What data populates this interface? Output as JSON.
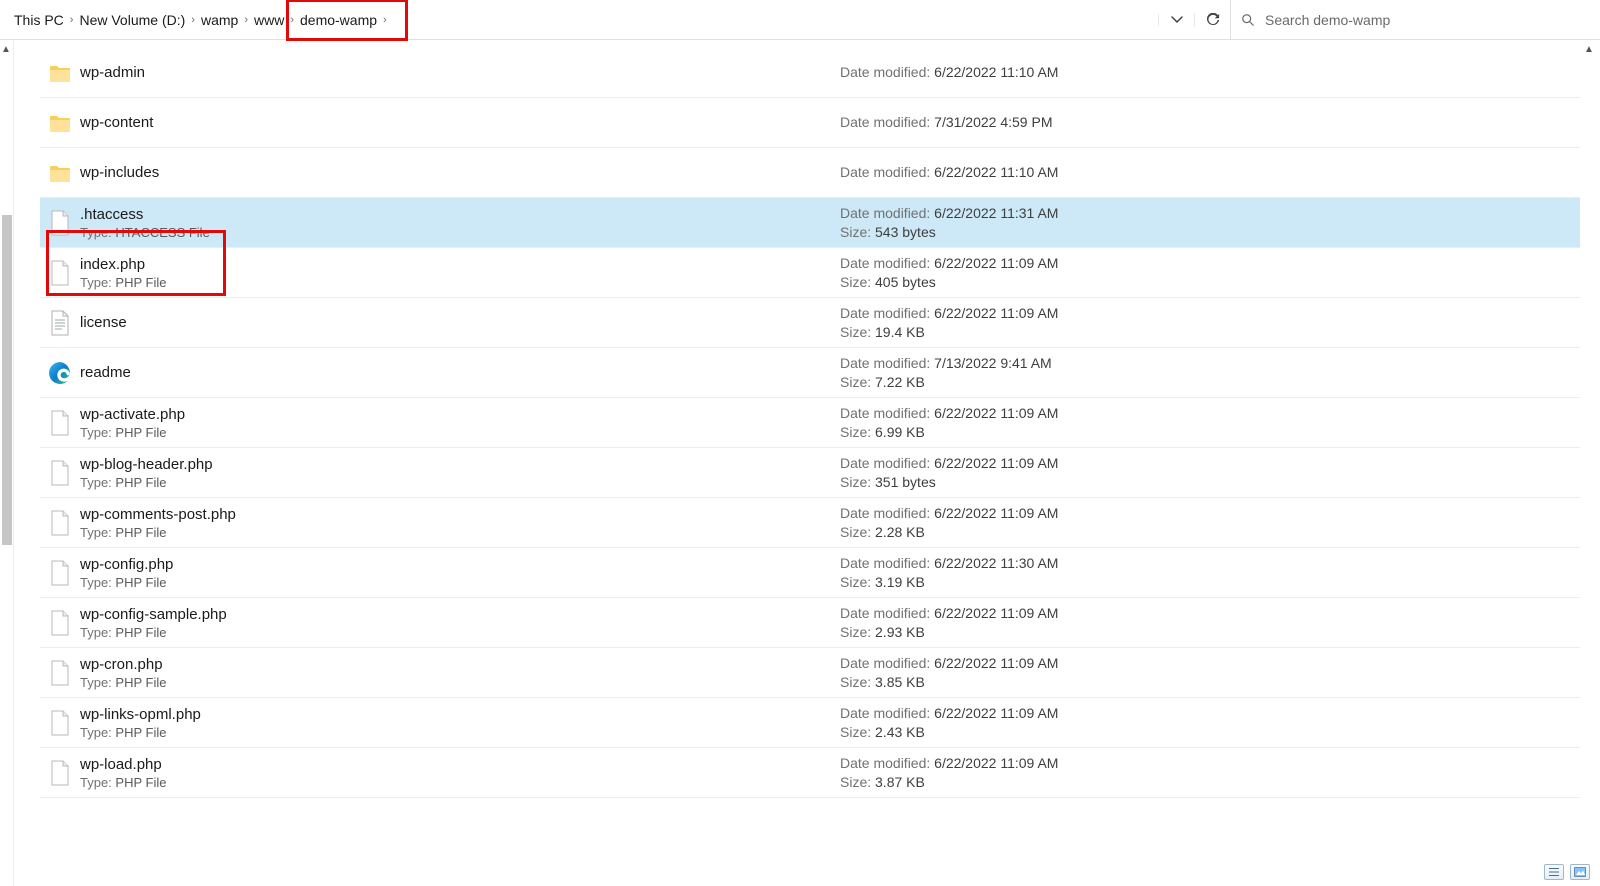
{
  "breadcrumbs": [
    "This PC",
    "New Volume (D:)",
    "wamp",
    "www",
    "demo-wamp"
  ],
  "search_placeholder": "Search demo-wamp",
  "labels": {
    "date_modified": "Date modified: ",
    "size": "Size: ",
    "type": "Type: "
  },
  "files": [
    {
      "name": "wp-admin",
      "icon": "folder",
      "type": null,
      "date": "6/22/2022 11:10 AM",
      "size": null,
      "selected": false
    },
    {
      "name": "wp-content",
      "icon": "folder",
      "type": null,
      "date": "7/31/2022 4:59 PM",
      "size": null,
      "selected": false
    },
    {
      "name": "wp-includes",
      "icon": "folder",
      "type": null,
      "date": "6/22/2022 11:10 AM",
      "size": null,
      "selected": false
    },
    {
      "name": ".htaccess",
      "icon": "blank",
      "type": "HTACCESS File",
      "date": "6/22/2022 11:31 AM",
      "size": "543 bytes",
      "selected": true
    },
    {
      "name": "index.php",
      "icon": "blank",
      "type": "PHP File",
      "date": "6/22/2022 11:09 AM",
      "size": "405 bytes",
      "selected": false
    },
    {
      "name": "license",
      "icon": "text",
      "type": null,
      "date": "6/22/2022 11:09 AM",
      "size": "19.4 KB",
      "selected": false
    },
    {
      "name": "readme",
      "icon": "edge",
      "type": null,
      "date": "7/13/2022 9:41 AM",
      "size": "7.22 KB",
      "selected": false
    },
    {
      "name": "wp-activate.php",
      "icon": "blank",
      "type": "PHP File",
      "date": "6/22/2022 11:09 AM",
      "size": "6.99 KB",
      "selected": false
    },
    {
      "name": "wp-blog-header.php",
      "icon": "blank",
      "type": "PHP File",
      "date": "6/22/2022 11:09 AM",
      "size": "351 bytes",
      "selected": false
    },
    {
      "name": "wp-comments-post.php",
      "icon": "blank",
      "type": "PHP File",
      "date": "6/22/2022 11:09 AM",
      "size": "2.28 KB",
      "selected": false
    },
    {
      "name": "wp-config.php",
      "icon": "blank",
      "type": "PHP File",
      "date": "6/22/2022 11:30 AM",
      "size": "3.19 KB",
      "selected": false
    },
    {
      "name": "wp-config-sample.php",
      "icon": "blank",
      "type": "PHP File",
      "date": "6/22/2022 11:09 AM",
      "size": "2.93 KB",
      "selected": false
    },
    {
      "name": "wp-cron.php",
      "icon": "blank",
      "type": "PHP File",
      "date": "6/22/2022 11:09 AM",
      "size": "3.85 KB",
      "selected": false
    },
    {
      "name": "wp-links-opml.php",
      "icon": "blank",
      "type": "PHP File",
      "date": "6/22/2022 11:09 AM",
      "size": "2.43 KB",
      "selected": false
    },
    {
      "name": "wp-load.php",
      "icon": "blank",
      "type": "PHP File",
      "date": "6/22/2022 11:09 AM",
      "size": "3.87 KB",
      "selected": false
    }
  ]
}
